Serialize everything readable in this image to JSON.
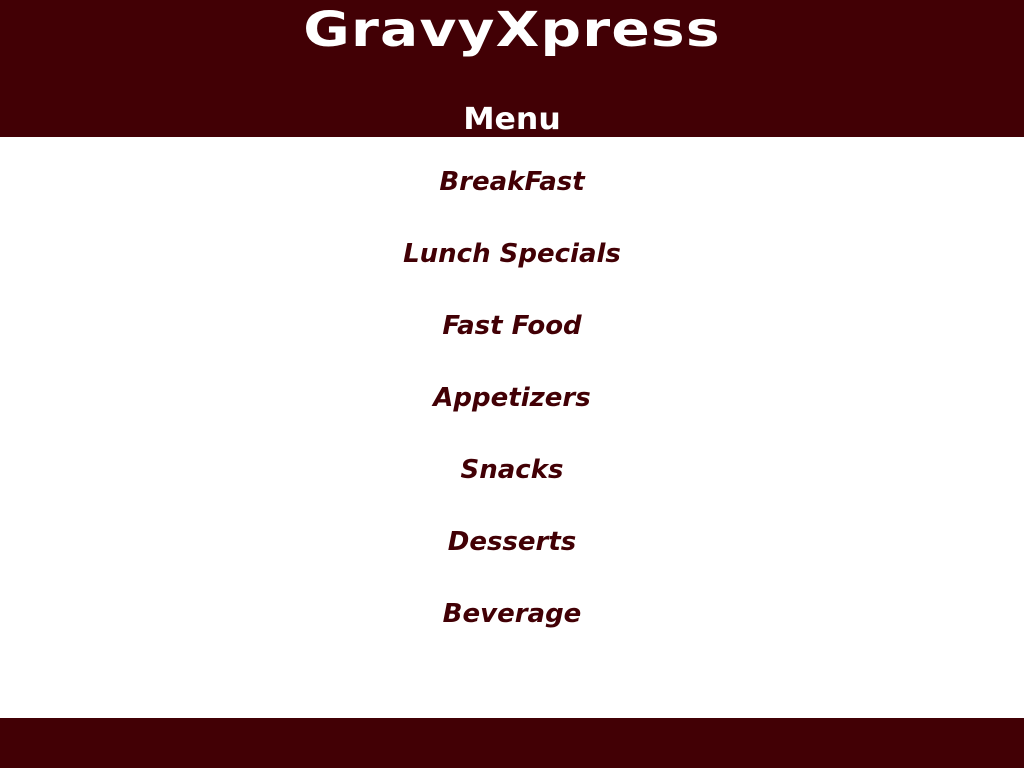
{
  "header": {
    "brand": "GravyXpress",
    "menu_title": "Menu"
  },
  "menu": {
    "items": [
      {
        "label": "BreakFast"
      },
      {
        "label": "Lunch Specials"
      },
      {
        "label": "Fast Food"
      },
      {
        "label": "Appetizers"
      },
      {
        "label": "Snacks"
      },
      {
        "label": "Desserts"
      },
      {
        "label": "Beverage"
      }
    ]
  },
  "colors": {
    "brand_dark_red": "#420005",
    "background": "#ffffff",
    "header_text": "#ffffff"
  }
}
